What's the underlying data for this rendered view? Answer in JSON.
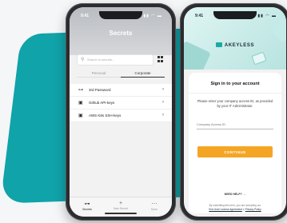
{
  "status_bar": {
    "time": "9:41",
    "icons": "▮▮ ◠ ▬"
  },
  "secrets_screen": {
    "title": "Secrets",
    "search_placeholder": "Search in secrets...",
    "tabs": [
      "Personal",
      "Corporate"
    ],
    "active_tab": "Corporate",
    "items": [
      {
        "icon": "key-icon",
        "label": "3rd Password"
      },
      {
        "icon": "credential-card-icon",
        "label": "Github API-keys"
      },
      {
        "icon": "credential-card-icon",
        "label": "AWS K8s SSH-keys"
      }
    ],
    "tabbar": [
      {
        "icon": "key-icon",
        "label": "Secrets",
        "active": true
      },
      {
        "icon": "plus-icon",
        "label": "New Secret",
        "active": false
      },
      {
        "icon": "more-icon",
        "label": "More",
        "active": false
      }
    ]
  },
  "signin_screen": {
    "brand": "AKEYLESS",
    "title": "Sign in to your account",
    "info": "Please enter your company access ID, as provided by your IT Administrator.",
    "input_placeholder": "Company Access ID",
    "button": "CONTINUE",
    "help": "NEED HELP? →",
    "legal_prefix": "By submitting this form, you are accepting our",
    "legal_eula": "End User License Agreement",
    "legal_and": "&",
    "legal_privacy": "Privacy Policy"
  },
  "colors": {
    "teal_blob": "#10a3a9",
    "continue_button": "#f5a524"
  }
}
